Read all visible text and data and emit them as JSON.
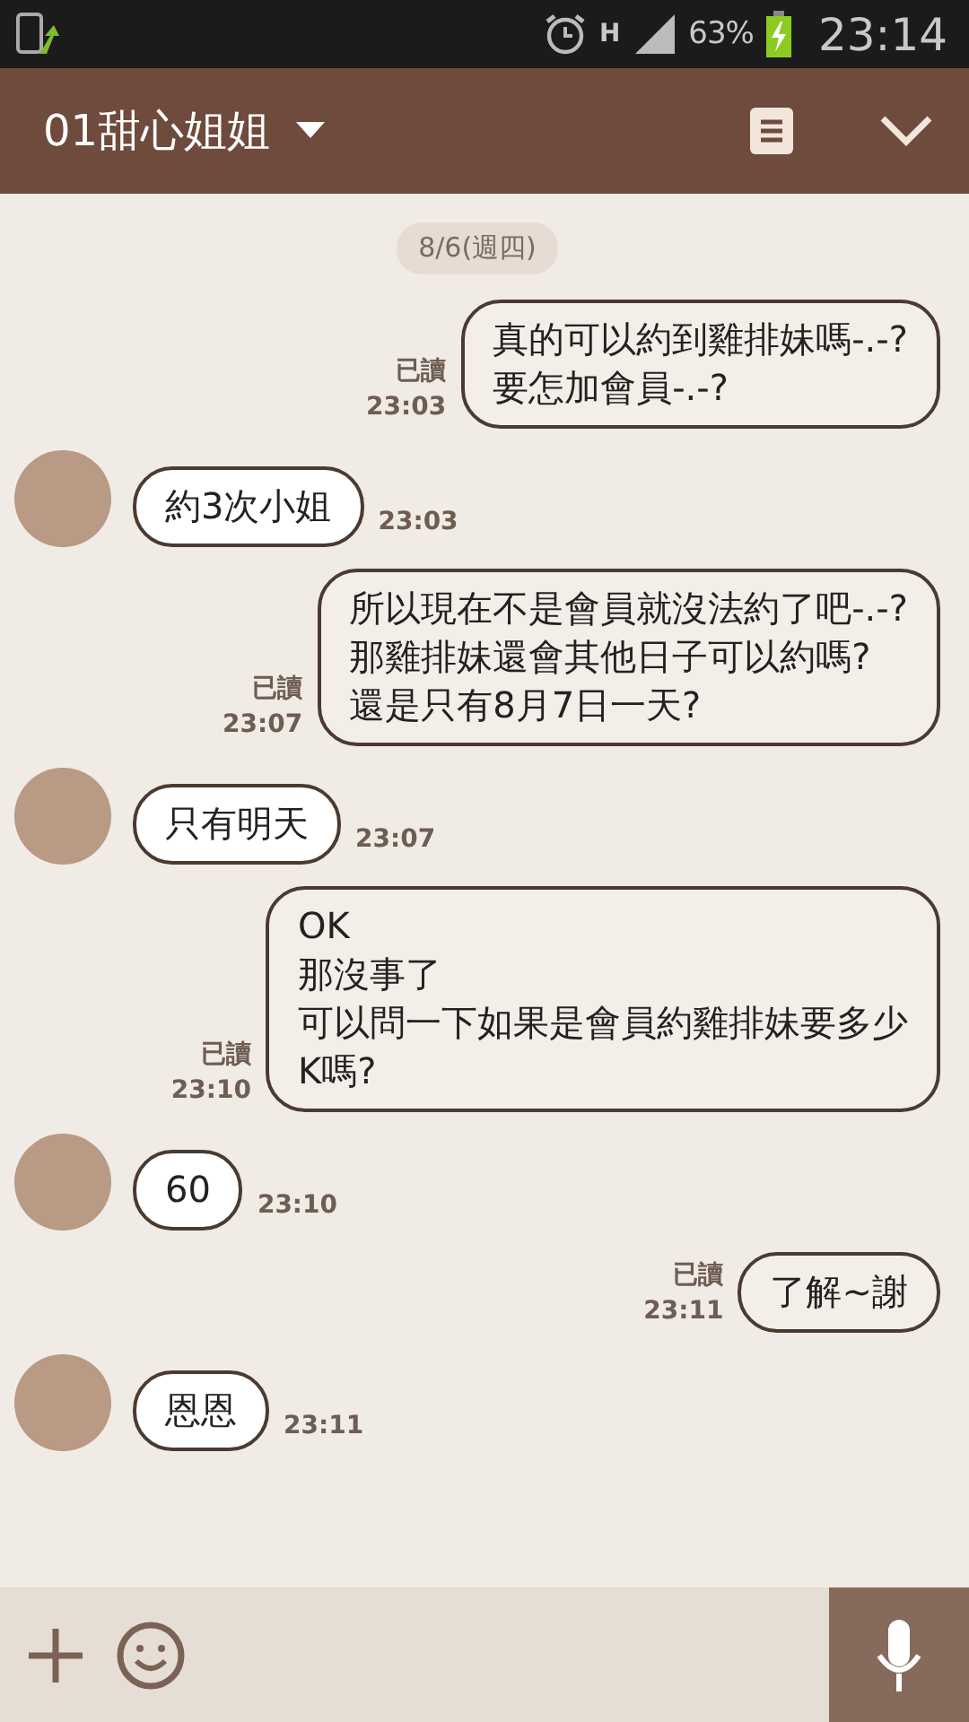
{
  "status_bar": {
    "network": "H",
    "battery": "63%",
    "time": "23:14"
  },
  "header": {
    "title": "01甜心姐姐"
  },
  "date_label": "8/6(週四)",
  "messages": [
    {
      "kind": "sent",
      "lines": [
        "真的可以約到雞排妹嗎-.-?",
        "要怎加會員-.-?"
      ],
      "read": "已讀",
      "time": "23:03"
    },
    {
      "kind": "received",
      "lines": [
        "約3次小姐"
      ],
      "time": "23:03"
    },
    {
      "kind": "sent",
      "lines": [
        "所以現在不是會員就沒法約了吧-.-?",
        "那雞排妹還會其他日子可以約嗎?",
        "還是只有8月7日一天?"
      ],
      "read": "已讀",
      "time": "23:07"
    },
    {
      "kind": "received",
      "lines": [
        "只有明天"
      ],
      "time": "23:07"
    },
    {
      "kind": "sent",
      "lines": [
        "OK",
        "那沒事了",
        "可以問一下如果是會員約雞排妹要多少",
        "K嗎?"
      ],
      "read": "已讀",
      "time": "23:10"
    },
    {
      "kind": "received",
      "lines": [
        "60"
      ],
      "time": "23:10"
    },
    {
      "kind": "sent",
      "lines": [
        "了解~謝"
      ],
      "read": "已讀",
      "time": "23:11"
    },
    {
      "kind": "received",
      "lines": [
        "恩恩"
      ],
      "time": "23:11"
    }
  ]
}
